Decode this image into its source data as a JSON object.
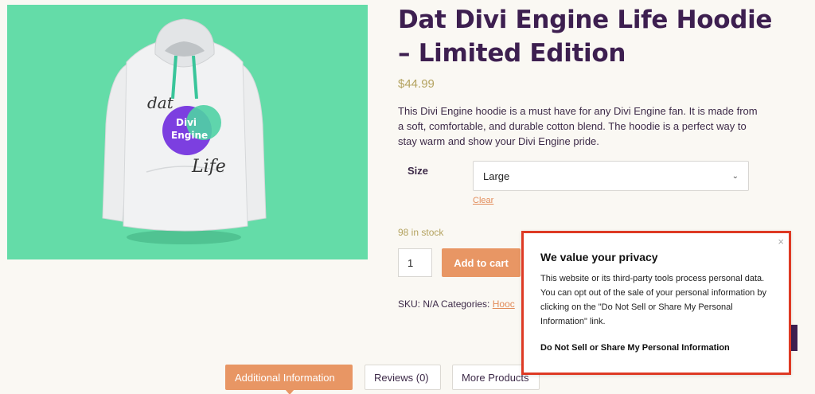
{
  "product": {
    "title": "Dat Divi Engine Life Hoodie – Limited Edition",
    "price": "$44.99",
    "description": "This Divi Engine hoodie is a must have for any Divi Engine fan. It is made from a soft, comfortable, and durable cotton blend. The hoodie is a perfect way to stay warm and show your Divi Engine pride.",
    "image": {
      "background_color": "#64dca8",
      "logo_text": [
        "dat",
        "Divi",
        "Engine",
        "Life"
      ]
    }
  },
  "variation": {
    "label": "Size",
    "selected": "Large",
    "clear_label": "Clear"
  },
  "stock_text": "98 in stock",
  "cart": {
    "quantity": "1",
    "add_label": "Add to cart"
  },
  "meta": {
    "sku_text": "SKU: N/A Categories:",
    "category_partial": "Hooc"
  },
  "tabs": [
    {
      "label": "Additional Information",
      "active": true
    },
    {
      "label": "Reviews (0)",
      "active": false
    },
    {
      "label": "More Products",
      "active": false
    }
  ],
  "privacy": {
    "title": "We value your privacy",
    "body": "This website or its third-party tools process personal data. You can opt out of the sale of your personal information by clicking on the \"Do Not Sell or Share My Personal Information\" link.",
    "link": "Do Not Sell or Share My Personal Information",
    "close_icon": "close-icon"
  },
  "colors": {
    "accent": "#e89664",
    "title": "#3d1f50",
    "price": "#b4a360",
    "highlight_border": "#de3a24"
  }
}
